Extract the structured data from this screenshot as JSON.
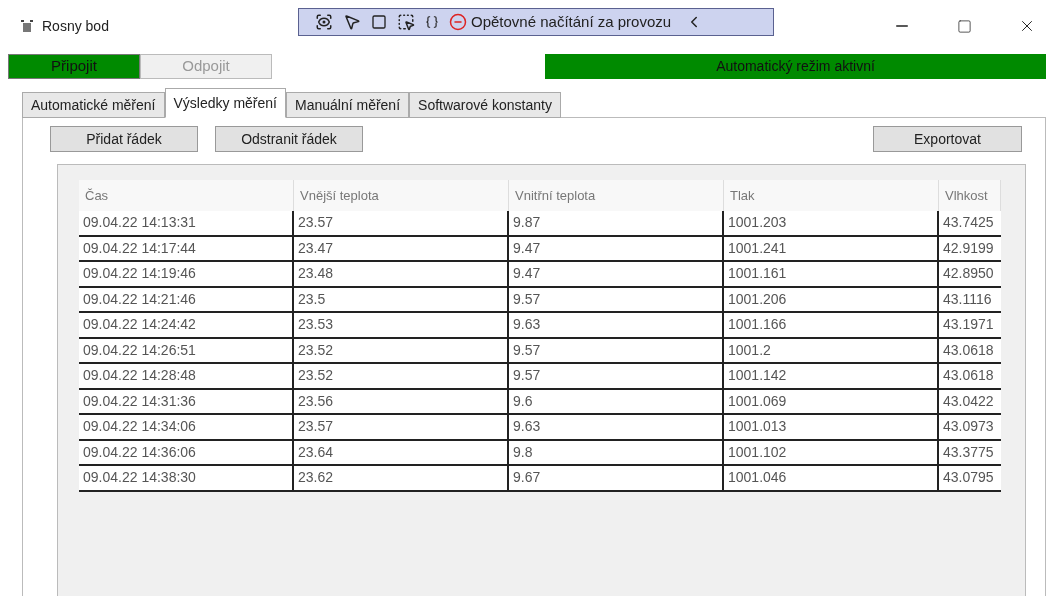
{
  "window": {
    "title": "Rosny bod"
  },
  "debug_toolbar": {
    "label": "Opětovné načítání za provozu"
  },
  "connection_buttons": [
    {
      "label": "Připojit",
      "active": true
    },
    {
      "label": "Odpojit",
      "active": false
    }
  ],
  "status_banner": {
    "text": "Automatický režim aktivní",
    "active": true
  },
  "tabs": [
    {
      "label": "Automatické měření",
      "selected": false
    },
    {
      "label": "Výsledky měření",
      "selected": true
    },
    {
      "label": "Manuální měření",
      "selected": false
    },
    {
      "label": "Softwarové konstanty",
      "selected": false
    }
  ],
  "actions": {
    "left": [
      "Přidat řádek",
      "Odstranit řádek"
    ],
    "right": [
      "Exportovat"
    ]
  },
  "table": {
    "columns": [
      "Čas",
      "Vnější teplota",
      "Vnitřní teplota",
      "Tlak",
      "Vlhkost"
    ],
    "rows": [
      [
        "09.04.22 14:13:31",
        "23.57",
        "9.87",
        "1001.203",
        "43.7425"
      ],
      [
        "09.04.22 14:17:44",
        "23.47",
        "9.47",
        "1001.241",
        "42.9199"
      ],
      [
        "09.04.22 14:19:46",
        "23.48",
        "9.47",
        "1001.161",
        "42.8950"
      ],
      [
        "09.04.22 14:21:46",
        "23.5",
        "9.57",
        "1001.206",
        "43.1116"
      ],
      [
        "09.04.22 14:24:42",
        "23.53",
        "9.63",
        "1001.166",
        "43.1971"
      ],
      [
        "09.04.22 14:26:51",
        "23.52",
        "9.57",
        "1001.2",
        "43.0618"
      ],
      [
        "09.04.22 14:28:48",
        "23.52",
        "9.57",
        "1001.142",
        "43.0618"
      ],
      [
        "09.04.22 14:31:36",
        "23.56",
        "9.6",
        "1001.069",
        "43.0422"
      ],
      [
        "09.04.22 14:34:06",
        "23.57",
        "9.63",
        "1001.013",
        "43.0973"
      ],
      [
        "09.04.22 14:36:06",
        "23.64",
        "9.8",
        "1001.102",
        "43.3775"
      ],
      [
        "09.04.22 14:38:30",
        "23.62",
        "9.67",
        "1001.046",
        "43.0795"
      ]
    ]
  }
}
